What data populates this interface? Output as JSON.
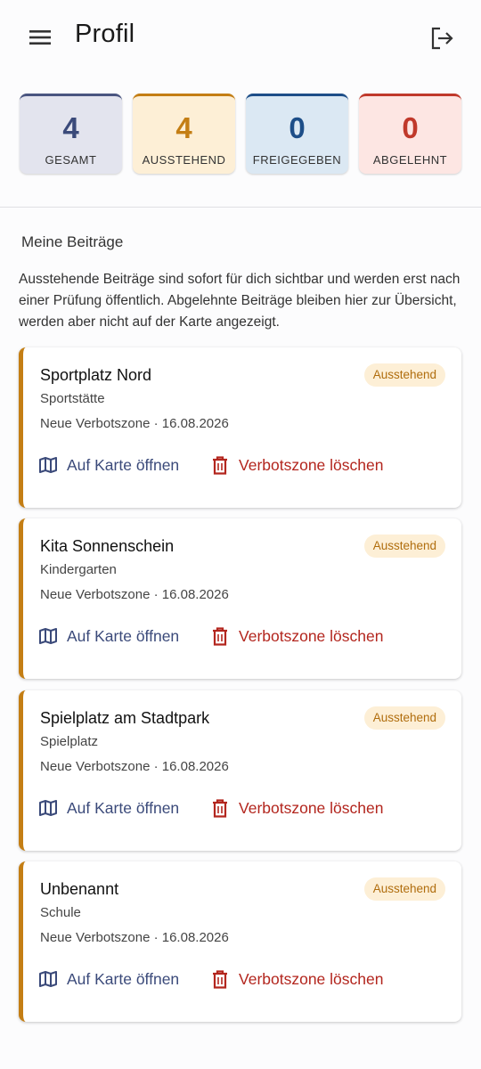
{
  "header": {
    "title": "Profil",
    "menu_icon": "menu-icon",
    "logout_icon": "logout-icon"
  },
  "stats": {
    "total": {
      "value": "4",
      "label": "GESAMT",
      "color": "#3b4a7a"
    },
    "pending": {
      "value": "4",
      "label": "AUSSTEHEND",
      "color": "#c47e14"
    },
    "approved": {
      "value": "0",
      "label": "FREIGEGEBEN",
      "color": "#1d4e88"
    },
    "rejected": {
      "value": "0",
      "label": "ABGELEHNT",
      "color": "#c0392b"
    }
  },
  "section": {
    "title": "Meine Beiträge",
    "info": "Ausstehende Beiträge sind sofort für dich sichtbar und werden erst nach einer Prüfung öffentlich. Abgelehnte Beiträge bleiben hier zur Übersicht, werden aber nicht auf der Karte angezeigt."
  },
  "actions": {
    "map_label": "Auf Karte öffnen",
    "delete_label": "Verbotszone löschen",
    "map_icon": "map-icon",
    "delete_icon": "trash-icon"
  },
  "cards": [
    {
      "name": "Sportplatz Nord",
      "type": "Sportstätte",
      "meta": "Neue Verbotszone · 16.08.2026",
      "status": "Ausstehend"
    },
    {
      "name": "Kita Sonnenschein",
      "type": "Kindergarten",
      "meta": "Neue Verbotszone · 16.08.2026",
      "status": "Ausstehend"
    },
    {
      "name": "Spielplatz am Stadtpark",
      "type": "Spielplatz",
      "meta": "Neue Verbotszone · 16.08.2026",
      "status": "Ausstehend"
    },
    {
      "name": "Unbenannt",
      "type": "Schule",
      "meta": "Neue Verbotszone · 16.08.2026",
      "status": "Ausstehend"
    }
  ]
}
